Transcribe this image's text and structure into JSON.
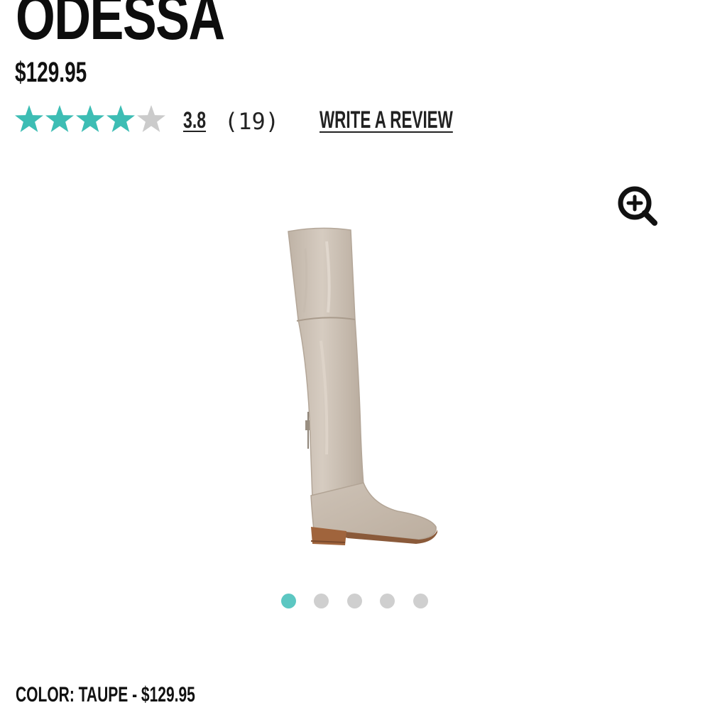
{
  "product": {
    "name": "ODESSA",
    "price": "$129.95"
  },
  "rating": {
    "value": "3.8",
    "count": "(19)",
    "stars_filled": 4,
    "stars_total": 5,
    "write_review_label": "WRITE A REVIEW"
  },
  "gallery": {
    "zoom_icon": "zoom-in-icon",
    "image_subject": "over-the-knee boot",
    "total_slides": 5,
    "active_slide": 1
  },
  "variant": {
    "color_label": "COLOR: TAUPE - $129.95"
  },
  "colors": {
    "star_filled": "#3dbdb4",
    "star_empty": "#cbcbcb",
    "dot_active": "#5cc7c2",
    "dot_inactive": "#cfcfcf",
    "text": "#111111",
    "boot": "#cbbfb2"
  }
}
